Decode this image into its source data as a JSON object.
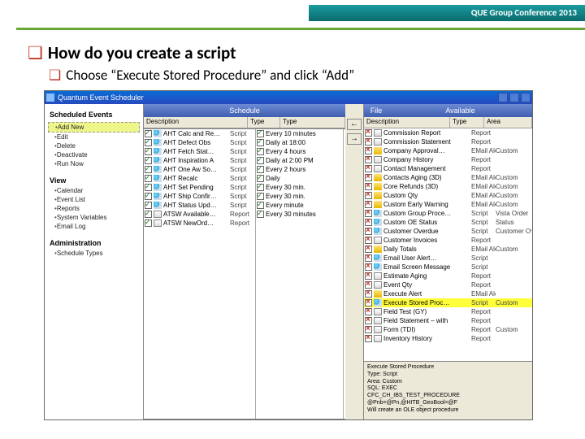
{
  "header": {
    "conf": "QUE Group Conference 2013"
  },
  "bullets": {
    "q1": "How do you create a script",
    "q2": "Choose “Execute Stored Procedure” and click “Add”"
  },
  "app": {
    "title": "Quantum Event Scheduler",
    "sidebar": {
      "heading": "Scheduled Events",
      "add": "Add New",
      "links": [
        "Edit",
        "Delete",
        "Deactivate",
        "Run Now"
      ],
      "viewHead": "View",
      "views": [
        "Calendar",
        "Event List",
        "Reports",
        "System Variables",
        "Email Log"
      ],
      "adminHead": "Administration",
      "admin": [
        "Schedule Types"
      ]
    },
    "bands": {
      "schedule": "Schedule",
      "file": "File",
      "available": "Available"
    },
    "cols": {
      "desc": "Description",
      "type": "Type",
      "area": "Area"
    },
    "scheduled": [
      {
        "on": true,
        "name": "AHT Calc and Re…",
        "type": "Script"
      },
      {
        "on": true,
        "name": "AHT Defect Obs",
        "type": "Script"
      },
      {
        "on": true,
        "name": "AHT Fetch Stat…",
        "type": "Script"
      },
      {
        "on": true,
        "name": "AHT Inspiration A",
        "type": "Script"
      },
      {
        "on": true,
        "name": "AHT One Aw So…",
        "type": "Script"
      },
      {
        "on": true,
        "name": "AHT Recalc",
        "type": "Script"
      },
      {
        "on": true,
        "name": "AHT Set Pending",
        "type": "Script"
      },
      {
        "on": true,
        "name": "AHT Ship Confir…",
        "type": "Script"
      },
      {
        "on": true,
        "name": "AHT Status Upd…",
        "type": "Script"
      },
      {
        "on": true,
        "name": "ATSW Available…",
        "type": "Report"
      },
      {
        "on": true,
        "name": "ATSW NewOrd…",
        "type": "Report"
      }
    ],
    "times": [
      {
        "on": true,
        "t": "Every 10 minutes"
      },
      {
        "on": true,
        "t": "Daily at 18:00"
      },
      {
        "on": true,
        "t": "Every 4 hours"
      },
      {
        "on": true,
        "t": "Daily at 2:00 PM"
      },
      {
        "on": true,
        "t": "Every 2 hours"
      },
      {
        "on": true,
        "t": "Daily"
      },
      {
        "on": true,
        "t": "Every 30 min."
      },
      {
        "on": true,
        "t": "Every 30 min."
      },
      {
        "on": true,
        "t": "Every minute"
      },
      {
        "on": true,
        "t": "Every 30 minutes"
      }
    ],
    "arrows": {
      "left": "←",
      "right": "→"
    },
    "available": [
      {
        "off": true,
        "name": "Commission Report",
        "type": "Report",
        "area": ""
      },
      {
        "off": true,
        "name": "Commission Statement",
        "type": "Report",
        "area": ""
      },
      {
        "off": true,
        "name": "Company Approval…",
        "type": "EMail Alert",
        "area": "Custom"
      },
      {
        "off": true,
        "name": "Company History",
        "type": "Report",
        "area": ""
      },
      {
        "off": true,
        "name": "Contact Management",
        "type": "Report",
        "area": ""
      },
      {
        "off": true,
        "name": "Contacts Aging (3D)",
        "type": "EMail Alert",
        "area": "Custom"
      },
      {
        "off": true,
        "name": "Core Refunds (3D)",
        "type": "EMail Alert",
        "area": "Custom"
      },
      {
        "off": true,
        "name": "Custom Qty",
        "type": "EMail Alert",
        "area": "Custom"
      },
      {
        "off": true,
        "name": "Custom Early Warning",
        "type": "EMail Alert",
        "area": "Custom"
      },
      {
        "off": true,
        "name": "Custom Group Proce…",
        "type": "Script",
        "area": "Vista Order"
      },
      {
        "off": true,
        "name": "Custom OE Status",
        "type": "Script",
        "area": "Status"
      },
      {
        "off": true,
        "name": "Customer Overdue",
        "type": "Script",
        "area": "Customer Overdue"
      },
      {
        "off": true,
        "name": "Customer Invoices",
        "type": "Report",
        "area": ""
      },
      {
        "off": true,
        "name": "Daily Totals",
        "type": "EMail Alert",
        "area": "Custom"
      },
      {
        "off": true,
        "name": "Email User Alert…",
        "type": "Script",
        "area": ""
      },
      {
        "off": true,
        "name": "Email Screen Message",
        "type": "Script",
        "area": ""
      },
      {
        "off": true,
        "name": "Estimate Aging",
        "type": "Report",
        "area": ""
      },
      {
        "off": true,
        "name": "Event Qty",
        "type": "Report",
        "area": ""
      },
      {
        "off": true,
        "name": "Execute Alert",
        "type": "EMail Alert",
        "area": ""
      },
      {
        "off": true,
        "name": "Execute Stored Proc…",
        "type": "Script",
        "area": "Custom",
        "hl": true
      },
      {
        "off": true,
        "name": "Field Test (GY)",
        "type": "Report",
        "area": ""
      },
      {
        "off": true,
        "name": "Field Statement – with",
        "type": "Report",
        "area": ""
      },
      {
        "off": true,
        "name": "Form (TDI)",
        "type": "Report",
        "area": "Custom"
      },
      {
        "off": true,
        "name": "Inventory History",
        "type": "Report",
        "area": ""
      }
    ],
    "detail": {
      "title": "Execute Stored Procedure",
      "l2": "Type: Script",
      "l3": "Area: Custom",
      "l4": "SQL: EXEC",
      "l5": "CFC_CH_IBS_TEST_PROCEDURE @Pnb=@Pn,@HITB_GeoBool=@F",
      "l6": "Will create an OLE object procedure"
    }
  }
}
